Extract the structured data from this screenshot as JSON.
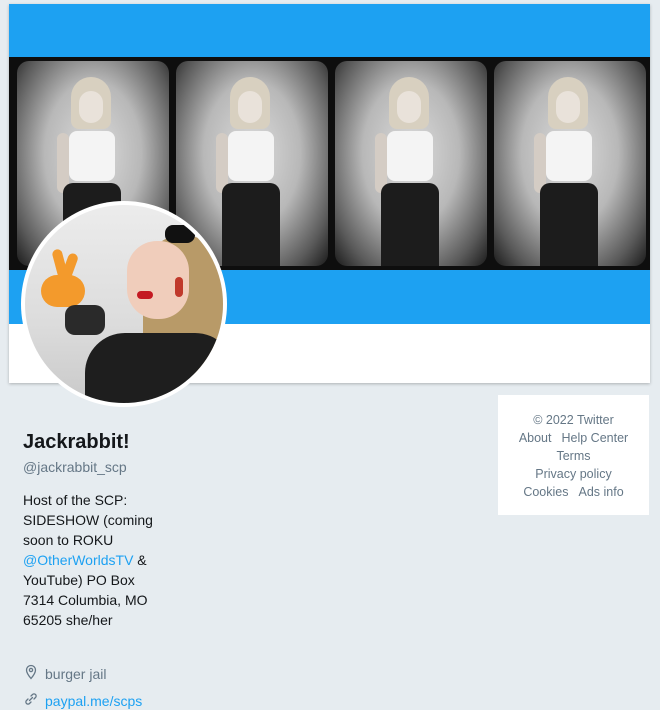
{
  "profile": {
    "name": "Jackrabbit!",
    "handle": "@jackrabbit_scp",
    "bio_before": "Host of the SCP: SIDESHOW (coming soon to ROKU ",
    "bio_link": "@OtherWorldsTV",
    "bio_after": " & YouTube) PO Box 7314 Columbia, MO 65205 she/her",
    "location": "burger jail",
    "website": "paypal.me/scps"
  },
  "footer": {
    "copyright": "© 2022 Twitter",
    "about": "About",
    "help_center": "Help Center",
    "terms": "Terms",
    "privacy": "Privacy policy",
    "cookies": "Cookies",
    "ads_info": "Ads info"
  },
  "colors": {
    "accent": "#1da1f2",
    "background": "#e6ecf0",
    "text_secondary": "#657786"
  },
  "icons": {
    "location": "location-pin-icon",
    "website": "link-icon"
  }
}
